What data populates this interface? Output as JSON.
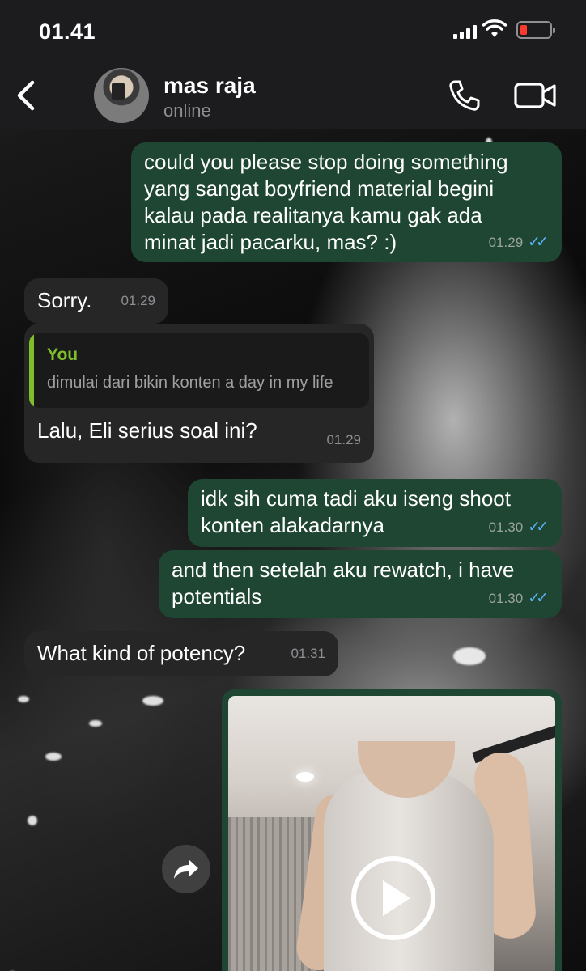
{
  "status_bar": {
    "time": "01.41"
  },
  "header": {
    "contact_name": "mas raja",
    "contact_status": "online",
    "icons": [
      "back-chevron-icon",
      "phone-icon",
      "video-camera-icon"
    ]
  },
  "messages": [
    {
      "direction": "out",
      "text_lines": [
        "could you please stop doing something",
        "yang sangat boyfriend material begini",
        "kalau pada realitanya kamu gak ada",
        "minat jadi pacarku, mas? :)"
      ],
      "time": "01.29",
      "read": true
    },
    {
      "direction": "in",
      "text_lines": [
        "Sorry."
      ],
      "time": "01.29"
    },
    {
      "direction": "in",
      "quote": {
        "author": "You",
        "text": "dimulai dari bikin konten a day in my life"
      },
      "text_lines": [
        "Lalu, Eli serius soal ini?"
      ],
      "time": "01.29"
    },
    {
      "direction": "out",
      "text_lines": [
        "idk sih cuma tadi aku iseng shoot",
        "konten alakadarnya"
      ],
      "time": "01.30",
      "read": true
    },
    {
      "direction": "out",
      "text_lines": [
        "and then setelah aku rewatch, i have",
        "potentials"
      ],
      "time": "01.30",
      "read": true
    },
    {
      "direction": "in",
      "text_lines": [
        "What kind of potency?"
      ],
      "time": "01.31"
    },
    {
      "direction": "out",
      "type": "video",
      "icon": "play-icon"
    }
  ],
  "colors": {
    "outgoing_bubble": "#1e4632",
    "incoming_bubble": "#262626",
    "read_ticks": "#5ab0f2",
    "quote_accent": "#7fbe2b"
  }
}
